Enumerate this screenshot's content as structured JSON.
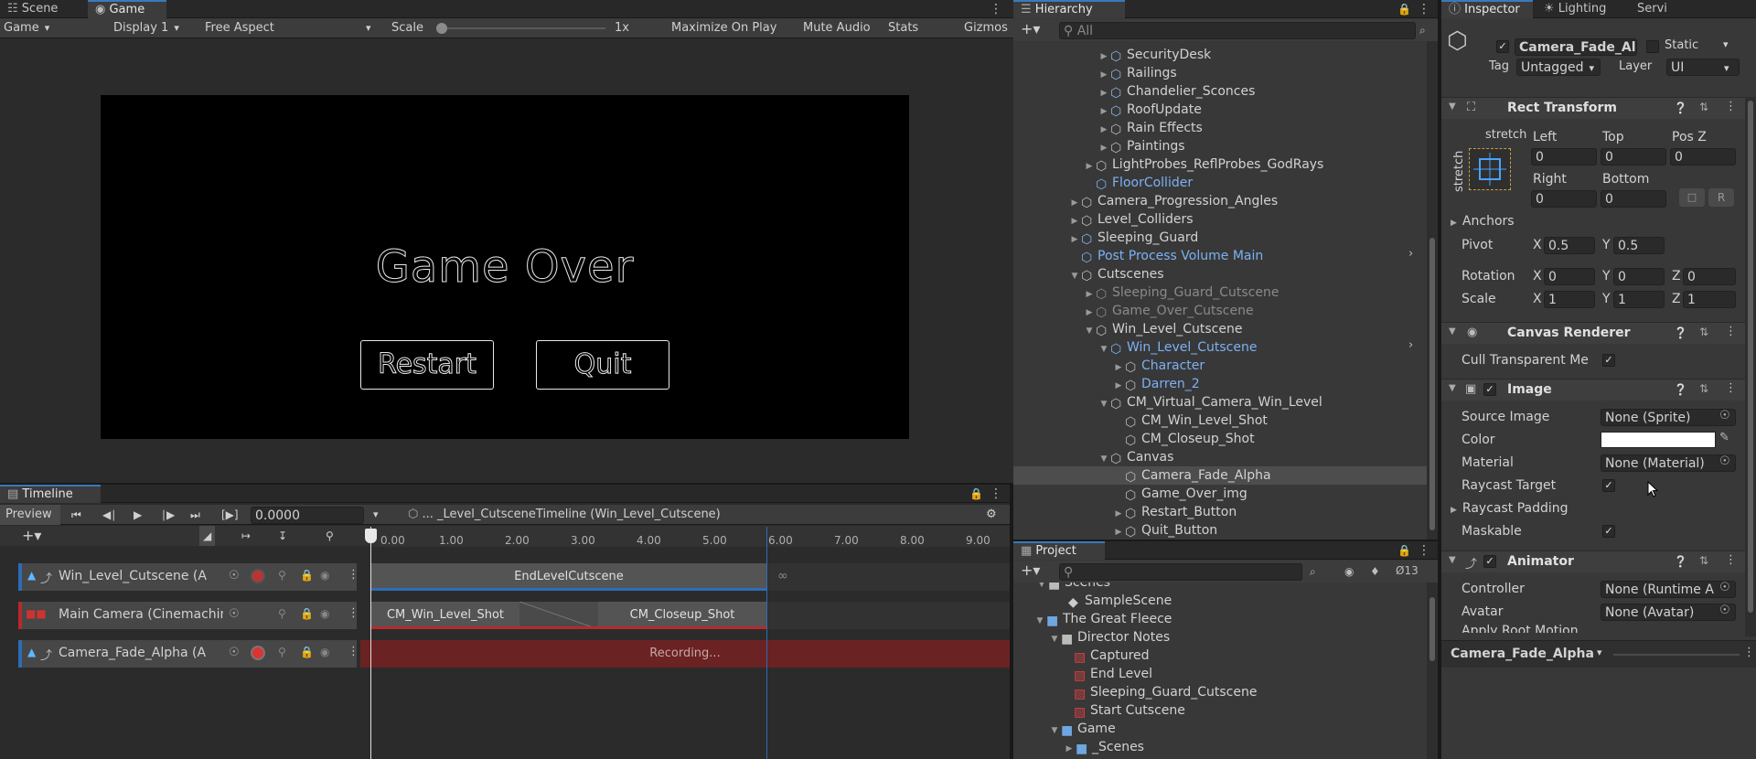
{
  "scene_tabs": [
    {
      "label": "Scene"
    },
    {
      "label": "Game"
    }
  ],
  "game_toolbar": {
    "display_mode": "Game",
    "display": "Display 1",
    "aspect": "Free Aspect",
    "scale_label": "Scale",
    "scale_value": "1x",
    "maximize": "Maximize On Play",
    "mute": "Mute Audio",
    "stats": "Stats",
    "gizmos": "Gizmos"
  },
  "game_view": {
    "title": "Game Over",
    "restart": "Restart",
    "quit": "Quit"
  },
  "timeline": {
    "tab": "Timeline",
    "preview": "Preview",
    "time": "0.0000",
    "asset": "... _Level_CutsceneTimeline (Win_Level_Cutscene)",
    "ticks": [
      "0.00",
      "1.00",
      "2.00",
      "3.00",
      "4.00",
      "5.00",
      "6.00",
      "7.00",
      "8.00",
      "9.00"
    ],
    "tracks": [
      {
        "name": "Win_Level_Cutscene (A"
      },
      {
        "name": "Main Camera (Cinemachine"
      },
      {
        "name": "Camera_Fade_Alpha (A"
      }
    ],
    "clips": {
      "end_level": "EndLevelCutscene",
      "cm_win": "CM_Win_Level_Shot",
      "cm_close": "CM_Closeup_Shot",
      "recording": "Recording..."
    }
  },
  "hierarchy": {
    "tab": "Hierarchy",
    "search_placeholder": "All",
    "items": [
      {
        "label": "SecurityDesk"
      },
      {
        "label": "Railings"
      },
      {
        "label": "Chandelier_Sconces"
      },
      {
        "label": "RoofUpdate"
      },
      {
        "label": "Rain Effects"
      },
      {
        "label": "Paintings"
      },
      {
        "label": "LightProbes_ReflProbes_GodRays"
      },
      {
        "label": "FloorCollider"
      },
      {
        "label": "Camera_Progression_Angles"
      },
      {
        "label": "Level_Colliders"
      },
      {
        "label": "Sleeping_Guard"
      },
      {
        "label": "Post Process Volume Main"
      },
      {
        "label": "Cutscenes"
      },
      {
        "label": "Sleeping_Guard_Cutscene"
      },
      {
        "label": "Game_Over_Cutscene"
      },
      {
        "label": "Win_Level_Cutscene"
      },
      {
        "label": "Win_Level_Cutscene"
      },
      {
        "label": "Character"
      },
      {
        "label": "Darren_2"
      },
      {
        "label": "CM_Virtual_Camera_Win_Level"
      },
      {
        "label": "CM_Win_Level_Shot"
      },
      {
        "label": "CM_Closeup_Shot"
      },
      {
        "label": "Canvas"
      },
      {
        "label": "Camera_Fade_Alpha"
      },
      {
        "label": "Game_Over_img"
      },
      {
        "label": "Restart_Button"
      },
      {
        "label": "Quit_Button"
      }
    ]
  },
  "project": {
    "tab": "Project",
    "hidden_count": "13",
    "items": [
      {
        "label": "Scenes"
      },
      {
        "label": "SampleScene"
      },
      {
        "label": "The Great Fleece"
      },
      {
        "label": "Director Notes"
      },
      {
        "label": "Captured"
      },
      {
        "label": "End Level"
      },
      {
        "label": "Sleeping_Guard_Cutscene"
      },
      {
        "label": "Start Cutscene"
      },
      {
        "label": "Game"
      },
      {
        "label": "_Scenes"
      }
    ]
  },
  "inspector": {
    "tabs": [
      {
        "label": "Inspector"
      },
      {
        "label": "Lighting"
      },
      {
        "label": "Servi"
      }
    ],
    "object_name": "Camera_Fade_Alp",
    "static_label": "Static",
    "tag_label": "Tag",
    "tag_value": "Untagged",
    "layer_label": "Layer",
    "layer_value": "UI",
    "rect_transform": {
      "title": "Rect Transform",
      "stretch_h": "stretch",
      "stretch_v": "stretch",
      "left_label": "Left",
      "left": "0",
      "top_label": "Top",
      "top": "0",
      "posz_label": "Pos Z",
      "posz": "0",
      "right_label": "Right",
      "right": "0",
      "bottom_label": "Bottom",
      "bottom": "0",
      "r_button": "R",
      "anchors": "Anchors",
      "pivot_label": "Pivot",
      "pivot_x": "0.5",
      "pivot_y": "0.5",
      "rotation_label": "Rotation",
      "rot_x": "0",
      "rot_y": "0",
      "rot_z": "0",
      "scale_label": "Scale",
      "scale_x": "1",
      "scale_y": "1",
      "scale_z": "1",
      "x": "X",
      "y": "Y",
      "z": "Z"
    },
    "canvas_renderer": {
      "title": "Canvas Renderer",
      "cull_label": "Cull Transparent Me"
    },
    "image": {
      "title": "Image",
      "source_label": "Source Image",
      "source_value": "None (Sprite)",
      "color_label": "Color",
      "color_value": "#ffffff",
      "material_label": "Material",
      "material_value": "None (Material)",
      "raycast_label": "Raycast Target",
      "raycast_padding": "Raycast Padding",
      "maskable_label": "Maskable"
    },
    "animator": {
      "title": "Animator",
      "controller_label": "Controller",
      "controller_value": "None (Runtime A",
      "avatar_label": "Avatar",
      "avatar_value": "None (Avatar)",
      "apply_root_motion": "Apply Root Motion"
    },
    "footer_name": "Camera_Fade_Alpha"
  },
  "colors": {
    "accent": "#3a79bb",
    "track_blue": "#2d6cb5",
    "track_red": "#b8282d",
    "recording": "#6b2222"
  }
}
